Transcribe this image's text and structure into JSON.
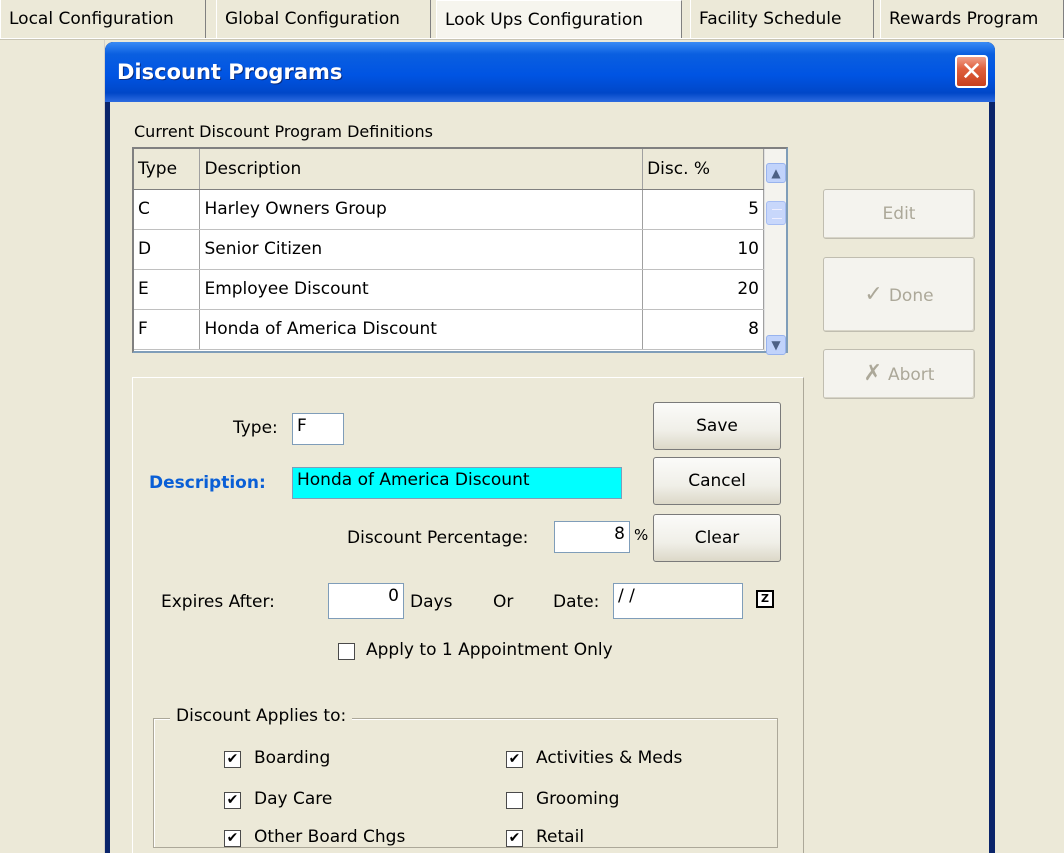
{
  "tabs": [
    {
      "label": "Local Configuration"
    },
    {
      "label": "Global Configuration"
    },
    {
      "label": "Look Ups Configuration"
    },
    {
      "label": "Facility Schedule"
    },
    {
      "label": "Rewards Program"
    }
  ],
  "active_tab": "Look Ups Configuration",
  "dialog": {
    "title": "Discount Programs",
    "close_glyph": "✕"
  },
  "grid": {
    "label": "Current Discount Program Definitions",
    "columns": [
      "Type",
      "Description",
      "Disc. %"
    ],
    "rows": [
      {
        "type": "C",
        "description": "Harley Owners Group",
        "pct": "5"
      },
      {
        "type": "D",
        "description": "Senior Citizen",
        "pct": "10"
      },
      {
        "type": "E",
        "description": "Employee Discount",
        "pct": "20"
      },
      {
        "type": "F",
        "description": "Honda of America Discount",
        "pct": "8"
      }
    ]
  },
  "side_buttons": {
    "edit": "Edit",
    "done": "Done",
    "abort": "Abort"
  },
  "form": {
    "type_label": "Type:",
    "type_value": "F",
    "description_label": "Description:",
    "description_value": "Honda of America Discount",
    "discount_pct_label": "Discount Percentage:",
    "discount_pct_value": "8",
    "pct_symbol": "%",
    "expires_label": "Expires After:",
    "days_value": "0",
    "days_label": "Days",
    "or_label": "Or",
    "date_label": "Date:",
    "date_value": " / /",
    "apply_one_label": "Apply to 1 Appointment Only",
    "apply_one_checked": false
  },
  "form_buttons": {
    "save": "Save",
    "cancel": "Cancel",
    "clear": "Clear"
  },
  "applies_to": {
    "title": "Discount Applies to:",
    "items": [
      {
        "label": "Boarding",
        "checked": true
      },
      {
        "label": "Day Care",
        "checked": true
      },
      {
        "label": "Other Board Chgs",
        "checked": true
      },
      {
        "label": "Activities & Meds",
        "checked": true
      },
      {
        "label": "Grooming",
        "checked": false
      },
      {
        "label": "Retail",
        "checked": true
      }
    ]
  },
  "icons": {
    "done_icon": "check-icon",
    "abort_icon": "x-icon",
    "calendar_icon": "calendar-icon",
    "check_glyph": "✔"
  }
}
